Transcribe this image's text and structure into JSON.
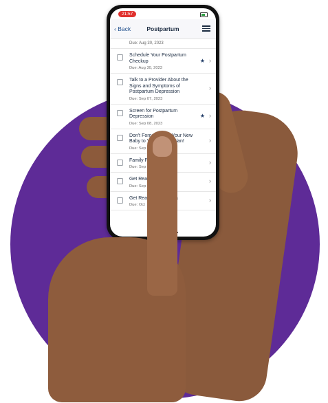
{
  "status": {
    "time": "21:57"
  },
  "nav": {
    "back_label": "Back",
    "title": "Postpartum"
  },
  "top_due": "Due: Aug 30, 2023",
  "items": [
    {
      "title": "Schedule Your Postpartum Checkup",
      "due": "Due: Aug 30, 2023",
      "starred": true
    },
    {
      "title": "Talk to a Provider About the Signs and Symptoms of Postpartum Depression",
      "due": "Due: Sep 07, 2023",
      "starred": false
    },
    {
      "title": "Screen for Postpartum Depression",
      "due": "Due: Sep 08, 2023",
      "starred": true
    },
    {
      "title": "Don't Forget to Add Your New Baby to Your Health Plan!",
      "due": "Due: Sep 1",
      "starred": false
    },
    {
      "title": "Family Pl",
      "due": "Due: Sep 1",
      "starred": false
    },
    {
      "title": "Get Read         irst Postpart",
      "due": "Due: Sep",
      "starred": false
    },
    {
      "title": "Get Rea         econd Postpa",
      "due": "Due: Oct",
      "starred": false
    }
  ],
  "colors": {
    "background_circle": "#5e2b97",
    "nav_text": "#1f4e8c",
    "star": "#1f3b66",
    "time_pill": "#e0312e"
  },
  "icons": {
    "back": "chevron-left-icon",
    "filter": "checklist-icon",
    "star": "star-icon",
    "chevron": "chevron-right-icon"
  }
}
